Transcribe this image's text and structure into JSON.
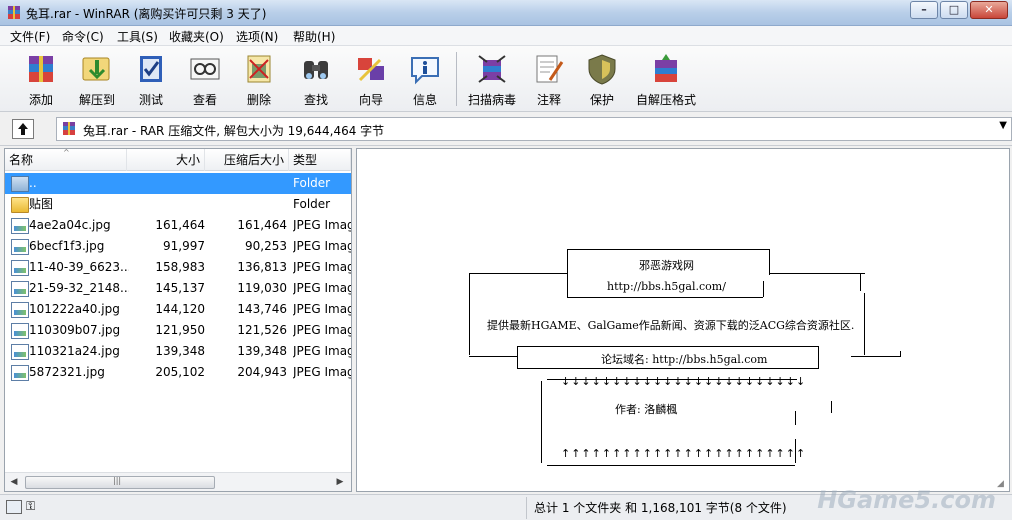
{
  "window": {
    "title": "兔耳.rar - WinRAR (离购买许可只剩 3 天了)"
  },
  "menu": [
    "文件(F)",
    "命令(C)",
    "工具(S)",
    "收藏夹(O)",
    "选项(N)",
    "帮助(H)"
  ],
  "toolbar": [
    {
      "label": "添加",
      "icon": "add-archive-icon"
    },
    {
      "label": "解压到",
      "icon": "extract-to-icon"
    },
    {
      "label": "测试",
      "icon": "test-icon"
    },
    {
      "label": "查看",
      "icon": "view-icon"
    },
    {
      "label": "删除",
      "icon": "delete-icon"
    },
    {
      "label": "查找",
      "icon": "find-icon"
    },
    {
      "label": "向导",
      "icon": "wizard-icon"
    },
    {
      "label": "信息",
      "icon": "info-icon"
    },
    {
      "label": "扫描病毒",
      "icon": "virus-scan-icon"
    },
    {
      "label": "注释",
      "icon": "comment-icon"
    },
    {
      "label": "保护",
      "icon": "protect-icon"
    },
    {
      "label": "自解压格式",
      "icon": "sfx-icon"
    }
  ],
  "address": {
    "text": "兔耳.rar - RAR 压缩文件, 解包大小为 19,644,464 字节"
  },
  "filelist": {
    "headers": {
      "name": "名称",
      "size": "大小",
      "packed": "压缩后大小",
      "type": "类型"
    },
    "rows": [
      {
        "name": "..",
        "size": "",
        "packed": "",
        "type": "Folder",
        "kind": "up",
        "selected": true
      },
      {
        "name": "贴图",
        "size": "",
        "packed": "",
        "type": "Folder",
        "kind": "folder"
      },
      {
        "name": "4ae2a04c.jpg",
        "size": "161,464",
        "packed": "161,464",
        "type": "JPEG Imag",
        "kind": "image"
      },
      {
        "name": "6becf1f3.jpg",
        "size": "91,997",
        "packed": "90,253",
        "type": "JPEG Imag",
        "kind": "image"
      },
      {
        "name": "11-40-39_6623...",
        "size": "158,983",
        "packed": "136,813",
        "type": "JPEG Imag",
        "kind": "image"
      },
      {
        "name": "21-59-32_2148...",
        "size": "145,137",
        "packed": "119,030",
        "type": "JPEG Imag",
        "kind": "image"
      },
      {
        "name": "101222a40.jpg",
        "size": "144,120",
        "packed": "143,746",
        "type": "JPEG Imag",
        "kind": "image"
      },
      {
        "name": "110309b07.jpg",
        "size": "121,950",
        "packed": "121,526",
        "type": "JPEG Imag",
        "kind": "image"
      },
      {
        "name": "110321a24.jpg",
        "size": "139,348",
        "packed": "139,348",
        "type": "JPEG Imag",
        "kind": "image"
      },
      {
        "name": "5872321.jpg",
        "size": "205,102",
        "packed": "204,943",
        "type": "JPEG Imag",
        "kind": "image"
      }
    ]
  },
  "comment": {
    "site_name": "邪恶游戏网",
    "site_url": "http://bbs.h5gal.com/",
    "description": "提供最新HGAME、GalGame作品新闻、资源下载的泛ACG综合资源社区.",
    "forum": "论坛域名: http://bbs.h5gal.com",
    "arrows_down": "↓↓↓↓↓↓↓↓↓↓↓↓↓↓↓↓↓↓↓↓↓↓↓↓",
    "author": "作者:  洛麟楓",
    "arrows_up": "↑↑↑↑↑↑↑↑↑↑↑↑↑↑↑↑↑↑↑↑↑↑↑↑"
  },
  "status": {
    "summary": "总计 1 个文件夹 和 1,168,101 字节(8 个文件)"
  },
  "watermark": "HGame5.com"
}
